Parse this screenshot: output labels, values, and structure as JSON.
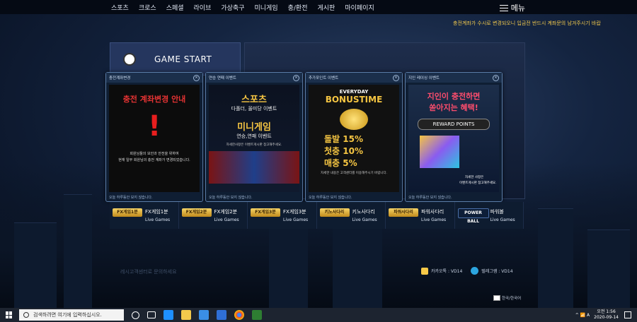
{
  "nav": {
    "items": [
      "스포츠",
      "크로스",
      "스페셜",
      "라이브",
      "가상축구",
      "미니게임",
      "충/환전",
      "게시판",
      "마이페이지"
    ],
    "menu_label": "메뉴"
  },
  "ticker": "충전계좌가 수시로 변경되오니 입금전 반드시 계좌문의 남겨주시기 바랍",
  "game_start": "GAME START",
  "popups": [
    {
      "title": "충전계좌변경",
      "lines": [
        "충전 계좌변경 안내",
        "회원님들의 보안과 안전을 위하여",
        "현재 일부 회원님의 충전 계좌가 변경되었습니다."
      ],
      "footer": "오늘 하루동안 보지 않습니다."
    },
    {
      "title": "연승 연패 이벤트",
      "lines": [
        "스포츠",
        "다폴더, 올미당 이벤트",
        "미니게임",
        "연승,연패 이벤트",
        "자세한사항은 이벤트게시판 참고해주세요."
      ],
      "footer": "오늘 하루동안 보지 않습니다."
    },
    {
      "title": "추가포인트 이벤트",
      "lines": [
        "EVERYDAY",
        "BONUSTIME",
        "돌발 15%",
        "첫충 10%",
        "매충 5%",
        "자세한 내용은 고객센터를 이용해주시기 바랍니다."
      ],
      "footer": "오늘 하루동안 보지 않습니다."
    },
    {
      "title": "지인 레이싱 이벤트",
      "lines": [
        "지인이 충전하면",
        "쏟아지는 혜택!",
        "REWARD POINTS",
        "자세한 사항은",
        "이벤트게시판 참고해주세요."
      ],
      "footer": "오늘 하루동안 보지 않습니다."
    }
  ],
  "games": [
    {
      "logo": "FX게임1분",
      "name": "FX게임1분",
      "sub": "Live Games"
    },
    {
      "logo": "FX게임2분",
      "name": "FX게임2분",
      "sub": "Live Games"
    },
    {
      "logo": "FX게임3분",
      "name": "FX게임3분",
      "sub": "Live Games"
    },
    {
      "logo": "키노사다리",
      "name": "키노사다리",
      "sub": "Live Games"
    },
    {
      "logo": "파워사다리",
      "name": "파워사다리",
      "sub": "Live Games"
    },
    {
      "logo": "POWER BALL",
      "name": "파워볼",
      "sub": "Live Games"
    }
  ],
  "faded_text": "레시고객센터로 문의하세요",
  "contacts": {
    "kakao": "카카오톡 : VD14",
    "telegram": "텔레그램 : VD14"
  },
  "lang": "한국/한국어",
  "taskbar": {
    "search_placeholder": "검색하려면 여기에 입력하십시오.",
    "tray_text": "^ 📶 A",
    "time": "오전 1:56",
    "date": "2020-09-14"
  }
}
